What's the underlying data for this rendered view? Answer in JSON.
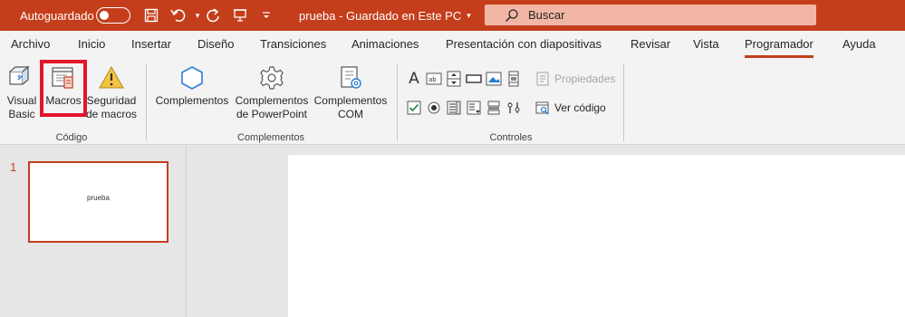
{
  "titlebar": {
    "autosave_label": "Autoguardado",
    "doc_title": "prueba  -  Guardado en Este PC",
    "search_placeholder": "Buscar",
    "icons": [
      "save-icon",
      "undo-icon",
      "redo-icon",
      "present-icon",
      "customize-icon"
    ]
  },
  "tabs": [
    "Archivo",
    "Inicio",
    "Insertar",
    "Diseño",
    "Transiciones",
    "Animaciones",
    "Presentación con diapositivas",
    "Revisar",
    "Vista",
    "Programador",
    "Ayuda"
  ],
  "active_tab": "Programador",
  "ribbon": {
    "codigo": {
      "label": "Código",
      "visual_basic_1": "Visual",
      "visual_basic_2": "Basic",
      "macros": "Macros",
      "security_1": "Seguridad",
      "security_2": "de macros"
    },
    "complementos": {
      "label": "Complementos",
      "complementos": "Complementos",
      "ppt_addins_1": "Complementos",
      "ppt_addins_2": "de PowerPoint",
      "com_addins_1": "Complementos",
      "com_addins_2": "COM"
    },
    "controles": {
      "label": "Controles",
      "propiedades": "Propiedades",
      "ver_codigo": "Ver código"
    }
  },
  "slides": {
    "number": "1",
    "thumb_text": "prueba"
  },
  "colors": {
    "accent": "#c43e1c",
    "highlight": "#e3152a",
    "search_bg": "#f1b6a5"
  }
}
